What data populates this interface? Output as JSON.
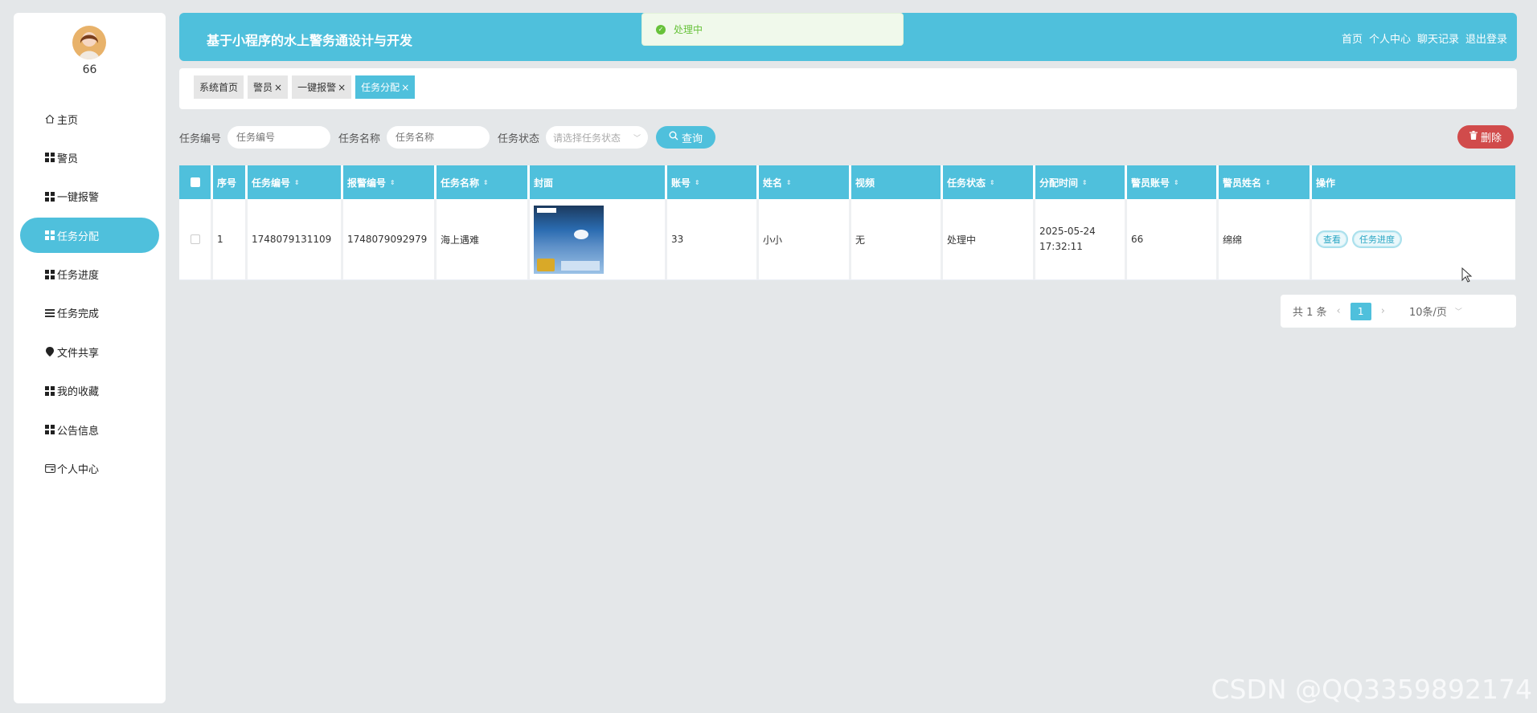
{
  "sidebar": {
    "username": "66",
    "items": [
      {
        "label": "主页",
        "icon": "home-icon"
      },
      {
        "label": "警员",
        "icon": "grid-icon"
      },
      {
        "label": "一键报警",
        "icon": "grid-icon"
      },
      {
        "label": "任务分配",
        "icon": "grid-icon",
        "active": true
      },
      {
        "label": "任务进度",
        "icon": "grid-icon"
      },
      {
        "label": "任务完成",
        "icon": "list-icon"
      },
      {
        "label": "文件共享",
        "icon": "pin-icon"
      },
      {
        "label": "我的收藏",
        "icon": "grid-icon"
      },
      {
        "label": "公告信息",
        "icon": "grid-icon"
      },
      {
        "label": "个人中心",
        "icon": "card-icon"
      }
    ]
  },
  "header": {
    "title": "基于小程序的水上警务通设计与开发",
    "nav": [
      "首页",
      "个人中心",
      "聊天记录",
      "退出登录"
    ]
  },
  "toast": {
    "message": "处理中"
  },
  "tabs": [
    {
      "label": "系统首页",
      "closable": false
    },
    {
      "label": "警员",
      "closable": true
    },
    {
      "label": "一键报警",
      "closable": true
    },
    {
      "label": "任务分配",
      "closable": true,
      "active": true
    }
  ],
  "search": {
    "task_no_label": "任务编号",
    "task_no_placeholder": "任务编号",
    "task_name_label": "任务名称",
    "task_name_placeholder": "任务名称",
    "task_status_label": "任务状态",
    "task_status_placeholder": "请选择任务状态",
    "query_label": "查询",
    "delete_label": "删除"
  },
  "table": {
    "columns": [
      "序号",
      "任务编号",
      "报警编号",
      "任务名称",
      "封面",
      "账号",
      "姓名",
      "视频",
      "任务状态",
      "分配时间",
      "警员账号",
      "警员姓名",
      "操作"
    ],
    "rows": [
      {
        "index": "1",
        "task_no": "1748079131109",
        "alarm_no": "1748079092979",
        "task_name": "海上遇难",
        "account": "33",
        "name": "小小",
        "video": "无",
        "status": "处理中",
        "assign_time": "2025-05-24 17:32:11",
        "officer_account": "66",
        "officer_name": "绵绵",
        "actions": [
          "查看",
          "任务进度"
        ]
      }
    ]
  },
  "pagination": {
    "total": "共 1 条",
    "current_page": "1",
    "page_size": "10条/页"
  },
  "watermark": "CSDN @QQ3359892174",
  "colors": {
    "accent": "#4fc0dc",
    "danger": "#d14b4b",
    "success": "#67c23a"
  }
}
